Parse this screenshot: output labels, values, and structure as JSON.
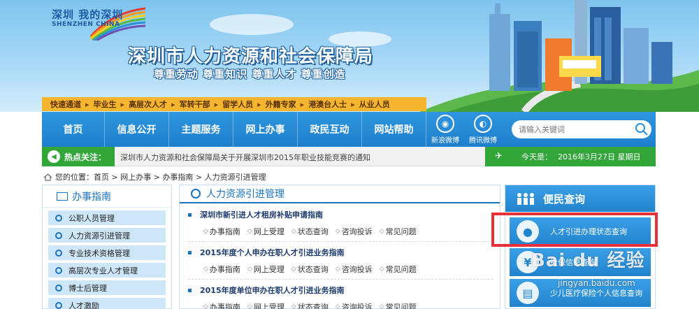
{
  "header": {
    "logo_cn": "深圳 我的深圳",
    "logo_en": "SHENZHEN CHINA",
    "org_title": "深圳市人力资源和社会保障局",
    "slogan": "尊重劳动 尊重知识 尊重人才 尊重创造"
  },
  "quick_links": {
    "label": "快速通道",
    "items": [
      "毕业生",
      "高层次人才",
      "军转干部",
      "留学人员",
      "外籍专家",
      "港澳台人士",
      "从业人员"
    ]
  },
  "nav": {
    "items": [
      "首页",
      "信息公开",
      "主题服务",
      "网上办事",
      "政民互动",
      "网站帮助"
    ],
    "weibo_sina": "新浪微博",
    "weibo_tencent": "腾讯微博",
    "search_placeholder": "请输入关键词"
  },
  "hotbar": {
    "label": "热点关注：",
    "text": "深圳市人力资源和社会保障局关于开展深圳市2015年职业技能竞赛的通知",
    "date_label": "今天是：",
    "date_value": "2016年3月27日  星期日"
  },
  "breadcrumb": {
    "prefix": "您的位置：",
    "items": [
      "首页",
      "网上办事",
      "办事指南",
      "人力资源引进管理"
    ]
  },
  "sidebar": {
    "title": "办事指南",
    "items": [
      "公职人员管理",
      "人力资源引进管理",
      "专业技术资格管理",
      "高层次专业人才管理",
      "博士后管理",
      "人才激励"
    ]
  },
  "main": {
    "title": "人力资源引进管理",
    "services": [
      {
        "title": "深圳市新引进人才租房补贴申请指南"
      },
      {
        "title": "2015年度个人申办在职人才引进业务指南"
      },
      {
        "title": "2015年度单位申办在职人才引进业务指南"
      }
    ],
    "links": [
      "办事指南",
      "网上受理",
      "状态查询",
      "咨询投诉",
      "常见问题"
    ]
  },
  "right": {
    "title": "便民查询",
    "buttons": [
      "人才引进办理状态查询",
      "社保信息查询",
      "少儿医疗保险个人信息查询"
    ]
  },
  "watermark": {
    "brand": "Bai du 经验",
    "url": "jingyan.baidu.com"
  }
}
